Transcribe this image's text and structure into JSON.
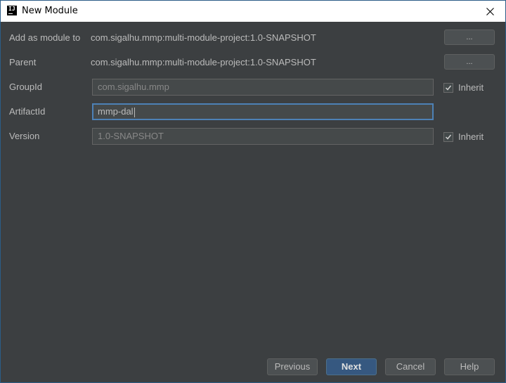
{
  "window": {
    "title": "New Module",
    "app_icon_text": "IJ"
  },
  "form": {
    "add_as_module": {
      "label": "Add as module to",
      "value": "com.sigalhu.mmp:multi-module-project:1.0-SNAPSHOT",
      "button": "..."
    },
    "parent": {
      "label": "Parent",
      "value": "com.sigalhu.mmp:multi-module-project:1.0-SNAPSHOT",
      "button": "..."
    },
    "group_id": {
      "label": "GroupId",
      "value": "com.sigalhu.mmp",
      "inherit_label": "Inherit",
      "inherit_checked": true
    },
    "artifact_id": {
      "label": "ArtifactId",
      "value": "mmp-dal"
    },
    "version": {
      "label": "Version",
      "value": "1.0-SNAPSHOT",
      "inherit_label": "Inherit",
      "inherit_checked": true
    }
  },
  "footer": {
    "previous": "Previous",
    "next": "Next",
    "cancel": "Cancel",
    "help": "Help"
  },
  "colors": {
    "background": "#3c3f41",
    "primary_button": "#365880",
    "focus_border": "#4d81b6"
  }
}
